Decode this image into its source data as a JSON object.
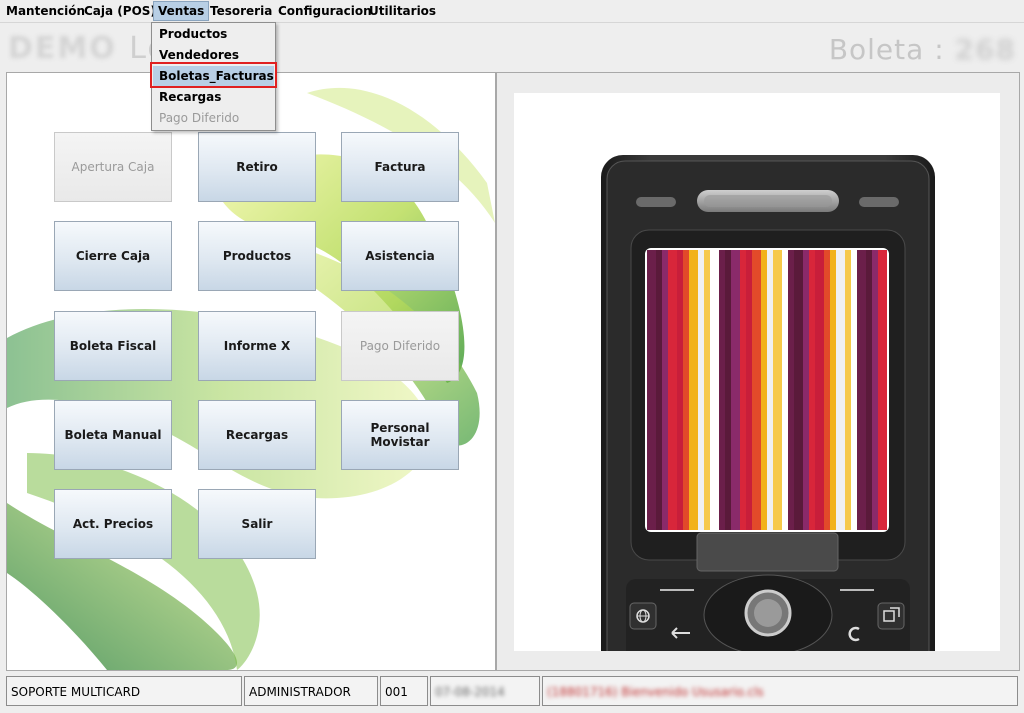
{
  "menubar": {
    "items": [
      {
        "label": "Mantención"
      },
      {
        "label": "Caja (POS)"
      },
      {
        "label": "Ventas"
      },
      {
        "label": "Tesoreria"
      },
      {
        "label": "Configuracion"
      },
      {
        "label": "Utilitarios"
      }
    ],
    "active": "Ventas"
  },
  "ventas_menu": {
    "items": [
      {
        "label": "Productos",
        "enabled": true
      },
      {
        "label": "Vendedores",
        "enabled": true
      },
      {
        "label": "Boletas_Facturas",
        "enabled": true,
        "selected": true
      },
      {
        "label": "Recargas",
        "enabled": true
      },
      {
        "label": "Pago Diferido",
        "enabled": false
      }
    ]
  },
  "title": {
    "left_blurred": "DEMO",
    "left_text": "Lo",
    "right_label": "Boleta :",
    "right_blurred": "268"
  },
  "buttons": {
    "apertura_caja": "Apertura Caja",
    "retiro": "Retiro",
    "factura": "Factura",
    "cierre_caja": "Cierre Caja",
    "productos": "Productos",
    "asistencia": "Asistencia",
    "boleta_fiscal": "Boleta Fiscal",
    "informe_x": "Informe X",
    "pago_diferido": "Pago Diferido",
    "boleta_manual": "Boleta Manual",
    "recargas": "Recargas",
    "personal_movistar": "Personal Movistar",
    "act_precios": "Act. Precios",
    "salir": "Salir"
  },
  "statusbar": {
    "company": "SOPORTE MULTICARD",
    "user": "ADMINISTRADOR",
    "code": "001",
    "date_blurred": "07-08-2014",
    "message_blurred": "(18801716) Bienvenido Ususario.cls"
  },
  "colors": {
    "menu_highlight": "#b8cfe5",
    "selection_outline": "#e02020",
    "button_top": "#f6f9fc",
    "button_bottom": "#c8d7e6",
    "phone_body": "#2a2a2a"
  },
  "icons": {
    "phone": "mobile-phone-image",
    "swirl": "green-swirl-logo",
    "globe": "globe-icon",
    "back": "back-arrow-icon",
    "clear": "clear-c-icon",
    "window": "window-icon"
  }
}
